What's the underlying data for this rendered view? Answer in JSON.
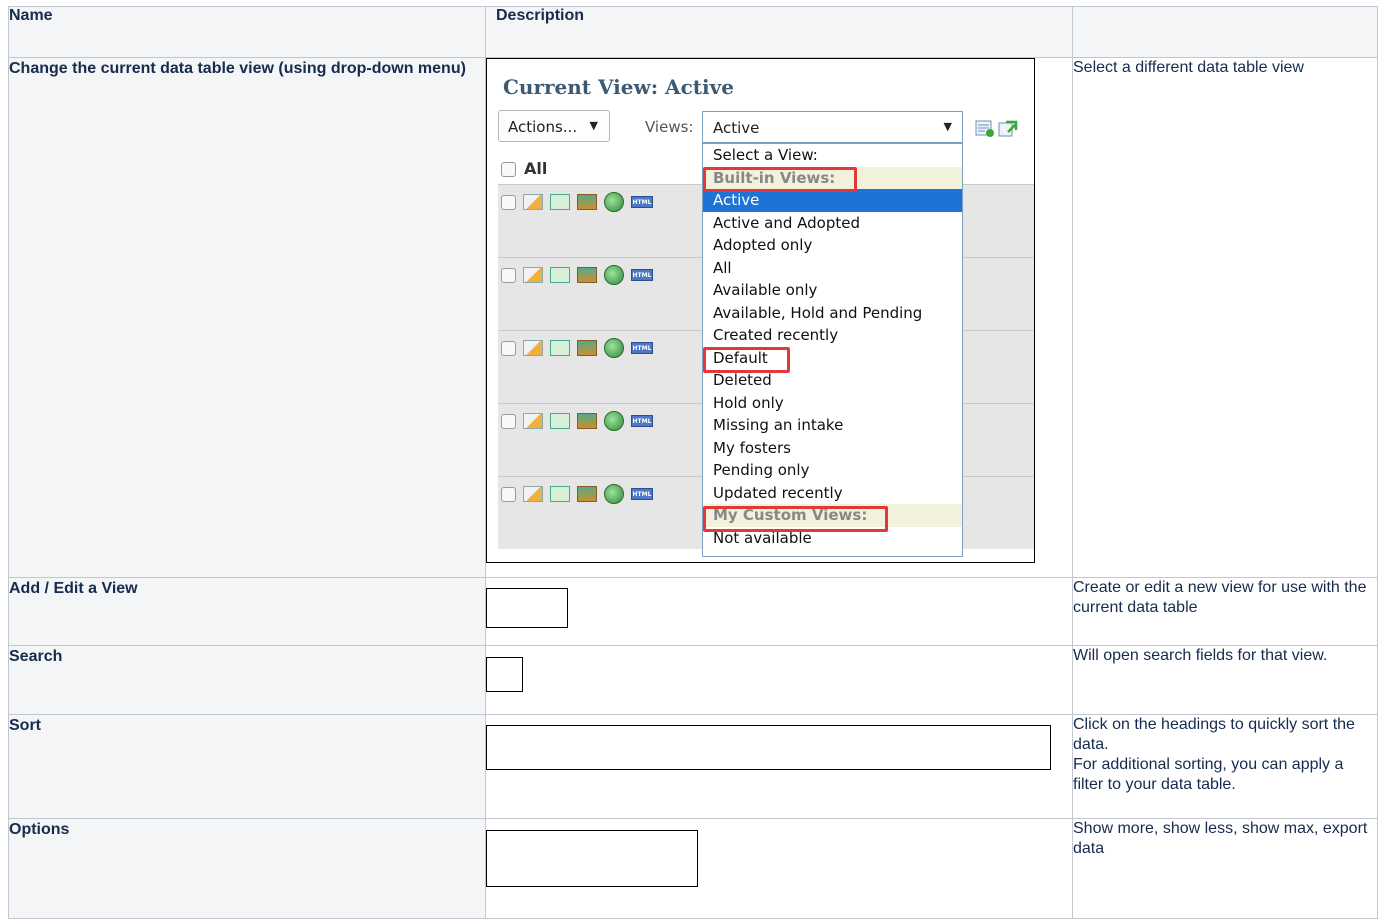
{
  "headers": {
    "name": "Name",
    "description": "Description",
    "third": ""
  },
  "rows": [
    {
      "name": "Change the current data table view (using drop-down menu)",
      "description_lines": [
        "Select a different data table view"
      ]
    },
    {
      "name": "Add / Edit a View",
      "description_lines": [
        "Create or edit a new view for use with the current data table"
      ]
    },
    {
      "name": "Search",
      "description_lines": [
        "Will open search fields for that view."
      ]
    },
    {
      "name": "Sort",
      "description_lines": [
        "Click on the headings to quickly sort the data.",
        "For additional sorting, you can apply a filter to your data table."
      ]
    },
    {
      "name": "Options",
      "description_lines": [
        "Show more, show less, show max, export data"
      ]
    }
  ],
  "screenshot": {
    "title": "Current View: Active",
    "actions_label": "Actions...",
    "views_label": "Views:",
    "views_selected": "Active",
    "all_label": "All",
    "dropdown_options": [
      {
        "label": "Select a View:",
        "kind": "option"
      },
      {
        "label": "Built-in Views:",
        "kind": "group"
      },
      {
        "label": "Active",
        "kind": "selected"
      },
      {
        "label": "Active and Adopted",
        "kind": "option"
      },
      {
        "label": "Adopted only",
        "kind": "option"
      },
      {
        "label": "All",
        "kind": "option"
      },
      {
        "label": "Available only",
        "kind": "option"
      },
      {
        "label": "Available, Hold and Pending",
        "kind": "option"
      },
      {
        "label": "Created recently",
        "kind": "option"
      },
      {
        "label": "Default",
        "kind": "option"
      },
      {
        "label": "Deleted",
        "kind": "option"
      },
      {
        "label": "Hold only",
        "kind": "option"
      },
      {
        "label": "Missing an intake",
        "kind": "option"
      },
      {
        "label": "My fosters",
        "kind": "option"
      },
      {
        "label": "Pending only",
        "kind": "option"
      },
      {
        "label": "Updated recently",
        "kind": "option"
      },
      {
        "label": "My Custom Views:",
        "kind": "group"
      },
      {
        "label": "Not available",
        "kind": "option"
      }
    ],
    "row_icons": [
      "edit-icon",
      "go-icon",
      "image-icon",
      "globe-icon",
      "html-icon"
    ],
    "html_icon_text": "HTML",
    "highlight_color": "#e2383a",
    "selected_color": "#1e73d6"
  }
}
